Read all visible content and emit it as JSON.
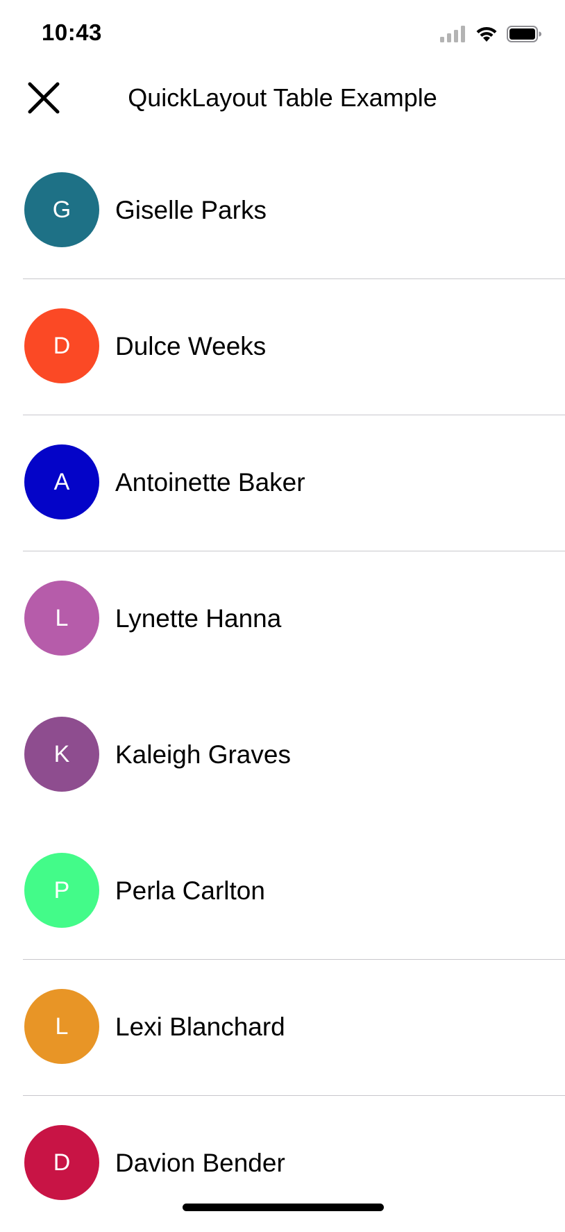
{
  "status": {
    "time": "10:43"
  },
  "nav": {
    "title": "QuickLayout Table Example",
    "close_icon": "close-icon"
  },
  "contacts": [
    {
      "initial": "G",
      "name": "Giselle Parks",
      "color": "#1E7186"
    },
    {
      "initial": "D",
      "name": "Dulce Weeks",
      "color": "#FB4925"
    },
    {
      "initial": "A",
      "name": "Antoinette Baker",
      "color": "#0404C8"
    },
    {
      "initial": "L",
      "name": "Lynette Hanna",
      "color": "#B65CAA"
    },
    {
      "initial": "K",
      "name": "Kaleigh Graves",
      "color": "#8E4D8F"
    },
    {
      "initial": "P",
      "name": "Perla Carlton",
      "color": "#43FB89"
    },
    {
      "initial": "L",
      "name": "Lexi Blanchard",
      "color": "#E89526"
    },
    {
      "initial": "D",
      "name": "Davion Bender",
      "color": "#C81445"
    }
  ]
}
